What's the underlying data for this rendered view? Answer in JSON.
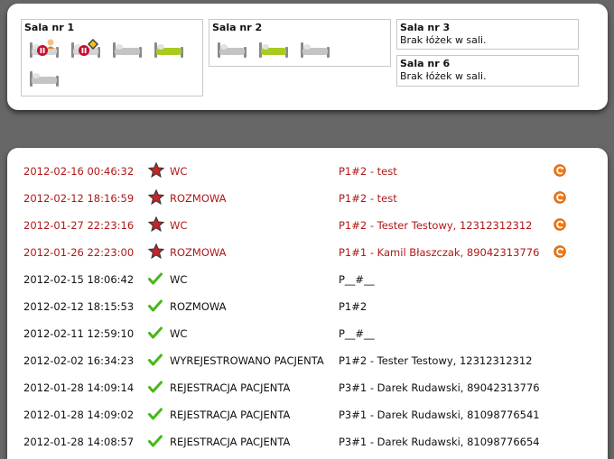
{
  "rooms": [
    {
      "title": "Sala nr 1",
      "message": "",
      "beds": [
        "patient-paused",
        "warning-paused",
        "empty",
        "occupied-green",
        "empty"
      ]
    },
    {
      "title": "Sala nr 2",
      "message": "",
      "beds": [
        "empty",
        "occupied-green",
        "empty"
      ]
    },
    {
      "title": "Sala nr 3",
      "message": "Brak łóżek w sali."
    },
    {
      "title": "Sala nr 6",
      "message": "Brak łóżek w sali."
    }
  ],
  "colors": {
    "alert_text": "#b01818",
    "normal_text": "#111111",
    "star": "#c0262a",
    "check": "#46b81a",
    "action": "#f07a14"
  },
  "events": [
    {
      "date": "2012-02-16 00:46:32",
      "status": "alert",
      "icon": "star-icon",
      "type": "WC",
      "patient": "P1#2 - test",
      "action": "return-icon"
    },
    {
      "date": "2012-02-12 18:16:59",
      "status": "alert",
      "icon": "star-icon",
      "type": "ROZMOWA",
      "patient": "P1#2 - test",
      "action": "return-icon"
    },
    {
      "date": "2012-01-27 22:23:16",
      "status": "alert",
      "icon": "star-icon",
      "type": "WC",
      "patient": "P1#2 - Tester Testowy, 12312312312",
      "action": "return-icon"
    },
    {
      "date": "2012-01-26 22:23:00",
      "status": "alert",
      "icon": "star-icon",
      "type": "ROZMOWA",
      "patient": "P1#1 - Kamil Błaszczak, 89042313776",
      "action": "return-icon"
    },
    {
      "date": "2012-02-15 18:06:42",
      "status": "ok",
      "icon": "check-icon",
      "type": "WC",
      "patient": "P__#__"
    },
    {
      "date": "2012-02-12 18:15:53",
      "status": "ok",
      "icon": "check-icon",
      "type": "ROZMOWA",
      "patient": "P1#2"
    },
    {
      "date": "2012-02-11 12:59:10",
      "status": "ok",
      "icon": "check-icon",
      "type": "WC",
      "patient": "P__#__"
    },
    {
      "date": "2012-02-02 16:34:23",
      "status": "ok",
      "icon": "check-icon",
      "type": "WYREJESTROWANO PACJENTA",
      "patient": "P1#2 - Tester Testowy, 12312312312"
    },
    {
      "date": "2012-01-28 14:09:14",
      "status": "ok",
      "icon": "check-icon",
      "type": "REJESTRACJA PACJENTA",
      "patient": "P3#1 - Darek Rudawski, 89042313776"
    },
    {
      "date": "2012-01-28 14:09:02",
      "status": "ok",
      "icon": "check-icon",
      "type": "REJESTRACJA PACJENTA",
      "patient": "P3#1 - Darek Rudawski, 81098776541"
    },
    {
      "date": "2012-01-28 14:08:57",
      "status": "ok",
      "icon": "check-icon",
      "type": "REJESTRACJA PACJENTA",
      "patient": "P3#1 - Darek Rudawski, 81098776654"
    }
  ]
}
